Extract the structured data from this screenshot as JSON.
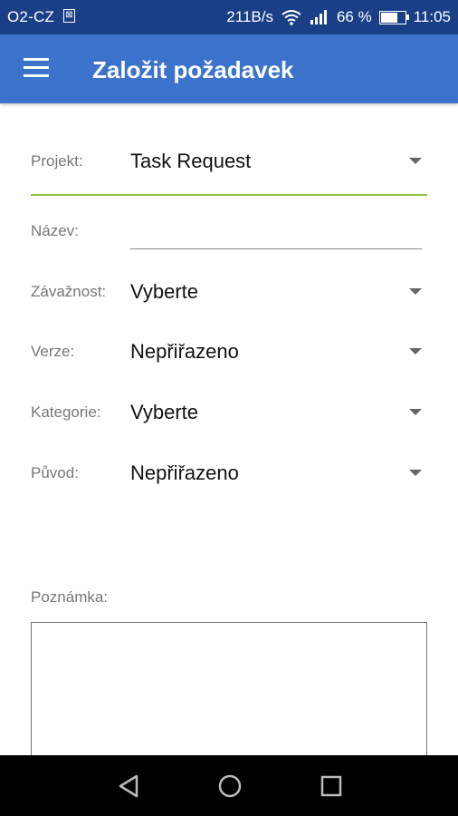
{
  "status_bar": {
    "carrier": "O2-CZ",
    "net_speed": "211B/s",
    "battery_percent": "66 %",
    "battery_level": 0.66,
    "time": "11:05",
    "icons": [
      "sim-card-icon",
      "wifi-icon",
      "signal-icon",
      "battery-icon"
    ]
  },
  "app_bar": {
    "title": "Založit požadavek",
    "menu_icon": "hamburger-menu-icon"
  },
  "form": {
    "project": {
      "label": "Projekt:",
      "value": "Task Request"
    },
    "name": {
      "label": "Název:",
      "value": ""
    },
    "severity": {
      "label": "Závažnost:",
      "value": "Vyberte"
    },
    "version": {
      "label": "Verze:",
      "value": "Nepřiřazeno"
    },
    "category": {
      "label": "Kategorie:",
      "value": "Vyberte"
    },
    "origin": {
      "label": "Původ:",
      "value": "Nepřiřazeno"
    },
    "note": {
      "label": "Poznámka:",
      "value": ""
    },
    "dropdown_icon": "caret-down-icon",
    "accent_color": "#9bc04a"
  },
  "colors": {
    "status_bar": "#1a3f86",
    "app_bar": "#3b73cc",
    "nav_bar": "#000000"
  },
  "nav_bar": {
    "icons": [
      "back-icon",
      "home-icon",
      "recents-icon"
    ]
  }
}
